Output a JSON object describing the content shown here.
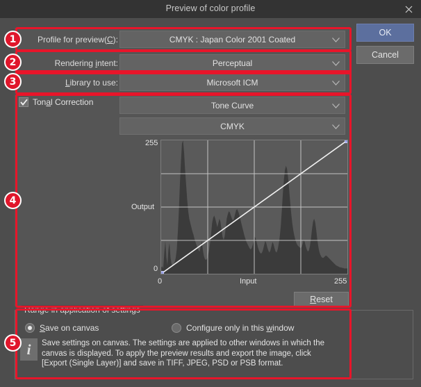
{
  "window": {
    "title": "Preview of color profile",
    "close_icon": "close-icon"
  },
  "fields": {
    "profile": {
      "label_pre": "Profile for preview(",
      "label_accel": "C",
      "label_post": "):",
      "value": "CMYK : Japan Color 2001 Coated",
      "chevron": "chevron-down-icon"
    },
    "intent": {
      "label_pre": "Rendering ",
      "label_accel": "i",
      "label_post": "ntent:",
      "value": "Perceptual",
      "chevron": "chevron-down-icon"
    },
    "library": {
      "label_pre": "",
      "label_accel": "L",
      "label_post": "ibrary to use:",
      "value": "Microsoft ICM",
      "chevron": "chevron-down-icon"
    }
  },
  "tonal": {
    "checkbox_label_pre": "Ton",
    "checkbox_label_accel": "a",
    "checkbox_label_post": "l Correction",
    "checked": true,
    "check_icon": "check-icon",
    "mode": "Tone Curve",
    "channel": "CMYK",
    "reset_accel": "R",
    "reset_post": "eset",
    "axis": {
      "y_max": "255",
      "y_min": "0",
      "y_title": "Output",
      "x_min": "0",
      "x_max": "255",
      "x_title": "Input"
    }
  },
  "range_group": {
    "title": "Range in application of settings",
    "radio_save": {
      "accel": "S",
      "post": "ave on canvas",
      "selected": true
    },
    "radio_window": {
      "pre": "Configure only in this ",
      "accel": "w",
      "post": "indow",
      "selected": false
    },
    "info_icon": "info-icon",
    "info_text": "Save settings on canvas. The settings are applied to other windows in which the canvas is displayed. To apply the preview results and export the image, click [Export (Single Layer)] and save in TIFF, JPEG, PSD or PSB format."
  },
  "buttons": {
    "ok": "OK",
    "cancel": "Cancel"
  },
  "annotations": {
    "badges": [
      "1",
      "2",
      "3",
      "4",
      "5"
    ]
  },
  "chart_data": {
    "type": "area",
    "title": "Tone Curve",
    "xlabel": "Input",
    "ylabel": "Output",
    "xlim": [
      0,
      255
    ],
    "ylim": [
      0,
      255
    ],
    "grid": true,
    "curve": [
      [
        0,
        0
      ],
      [
        255,
        255
      ]
    ],
    "control_points": [
      [
        0,
        0
      ],
      [
        255,
        255
      ]
    ],
    "histogram": [
      12,
      14,
      10,
      40,
      62,
      30,
      16,
      46,
      58,
      30,
      18,
      16,
      18,
      22,
      30,
      46,
      78,
      118,
      170,
      212,
      246,
      252,
      230,
      196,
      168,
      140,
      118,
      104,
      96,
      88,
      80,
      74,
      66,
      60,
      54,
      48,
      44,
      42,
      52,
      62,
      46,
      34,
      28,
      26,
      28,
      34,
      44,
      58,
      76,
      96,
      106,
      110,
      104,
      96,
      88,
      96,
      104,
      98,
      84,
      70,
      64,
      70,
      86,
      104,
      112,
      118,
      116,
      110,
      104,
      100,
      104,
      112,
      120,
      122,
      118,
      112,
      104,
      96,
      88,
      80,
      72,
      66,
      60,
      56,
      52,
      48,
      46,
      48,
      54,
      62,
      70,
      66,
      58,
      50,
      44,
      40,
      38,
      40,
      46,
      54,
      62,
      58,
      50,
      44,
      40,
      44,
      52,
      60,
      56,
      48,
      42,
      40,
      46,
      56,
      70,
      90,
      120,
      152,
      178,
      196,
      204,
      198,
      182,
      160,
      136,
      114,
      96,
      82,
      72,
      64,
      58,
      54,
      52,
      50,
      48,
      50,
      56,
      64,
      60,
      52,
      46,
      42,
      44,
      52,
      66,
      84,
      98,
      104,
      98,
      84,
      66,
      52,
      42,
      36,
      32,
      30,
      30,
      32,
      34,
      34,
      32,
      30,
      28,
      26,
      24,
      22,
      20,
      18,
      16,
      15,
      14,
      13,
      12,
      12,
      11,
      11,
      10,
      10,
      10,
      10
    ]
  }
}
